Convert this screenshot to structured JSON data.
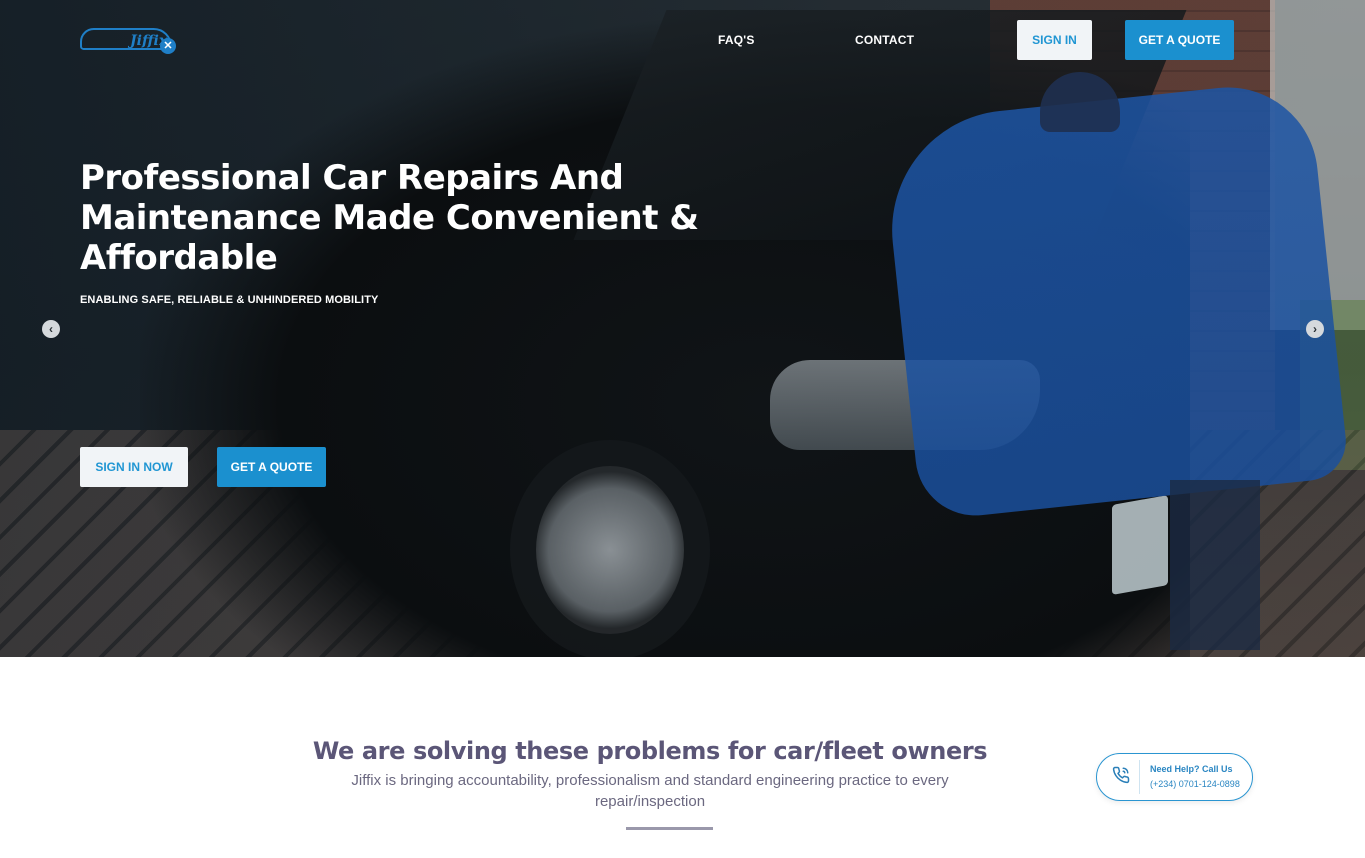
{
  "brand": {
    "logo_text": "Jiffix",
    "badge_glyph": "✕"
  },
  "nav": {
    "faqs": "FAQ'S",
    "contact": "CONTACT",
    "sign_in": "SIGN IN",
    "get_quote": "GET A QUOTE"
  },
  "hero": {
    "title": "Professional Car Repairs And Maintenance Made Convenient & Affordable",
    "subtitle": "ENABLING SAFE, RELIABLE & UNHINDERED MOBILITY",
    "sign_in_now": "SIGN IN NOW",
    "get_quote": "GET A QUOTE",
    "prev_glyph": "‹",
    "next_glyph": "›"
  },
  "section": {
    "title": "We are solving these problems for car/fleet owners",
    "description": "Jiffix is bringing accountability, professionalism and standard engineering practice to every repair/inspection"
  },
  "help": {
    "label": "Need Help? Call Us",
    "phone": "(+234) 0701-124-0898",
    "icon": "phone-icon"
  },
  "colors": {
    "accent": "#1b90cf",
    "heading": "#5b5677",
    "text": "#6b6880"
  }
}
